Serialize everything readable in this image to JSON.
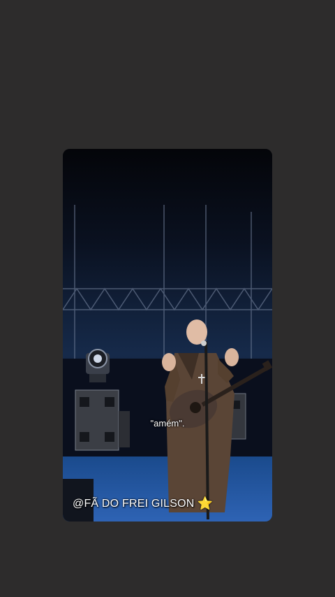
{
  "story": {
    "caption": "\"amém\".",
    "credit": "@FÃ DO FREI GILSON",
    "credit_icon": "star-icon",
    "star_glyph": "⭐"
  },
  "colors": {
    "background": "#2d2c2c",
    "stage_blue": "#1d4a8f",
    "robe": "#5a4536",
    "star": "#f7c718"
  }
}
